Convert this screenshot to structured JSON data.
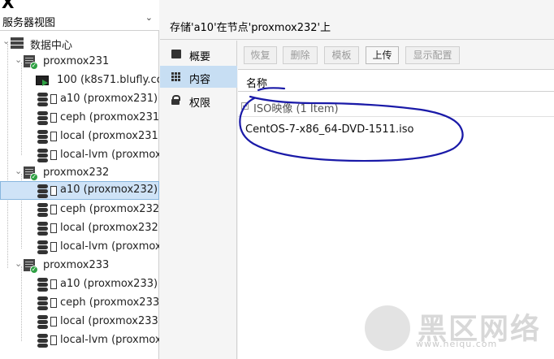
{
  "view_selector": {
    "label": "服务器视图"
  },
  "tree": {
    "datacenter": "数据中心",
    "nodes": [
      {
        "name": "proxmox231",
        "children": [
          {
            "type": "vm",
            "label": "100 (k8s71.blufly.com"
          },
          {
            "type": "storage",
            "label": "a10 (proxmox231)"
          },
          {
            "type": "storage",
            "label": "ceph (proxmox231)"
          },
          {
            "type": "storage",
            "label": "local (proxmox231)"
          },
          {
            "type": "storage",
            "label": "local-lvm (proxmox23"
          }
        ]
      },
      {
        "name": "proxmox232",
        "children": [
          {
            "type": "storage",
            "label": "a10 (proxmox232)",
            "selected": true
          },
          {
            "type": "storage",
            "label": "ceph (proxmox232)"
          },
          {
            "type": "storage",
            "label": "local (proxmox232)"
          },
          {
            "type": "storage",
            "label": "local-lvm (proxmox23"
          }
        ]
      },
      {
        "name": "proxmox233",
        "children": [
          {
            "type": "storage",
            "label": "a10 (proxmox233)"
          },
          {
            "type": "storage",
            "label": "ceph (proxmox233)"
          },
          {
            "type": "storage",
            "label": "local (proxmox233)"
          },
          {
            "type": "storage",
            "label": "local-lvm (proxmox23"
          }
        ]
      }
    ]
  },
  "header": {
    "title": "存储'a10'在节点'proxmox232'上"
  },
  "tabs": [
    {
      "label": "概要",
      "icon": "book-icon"
    },
    {
      "label": "内容",
      "icon": "grid-icon",
      "active": true
    },
    {
      "label": "权限",
      "icon": "lock-icon"
    }
  ],
  "toolbar": {
    "restore": "恢复",
    "remove": "删除",
    "template": "模板",
    "upload": "上传",
    "show_config": "显示配置"
  },
  "grid": {
    "column_name": "名称",
    "group_label": "ISO映像 (1 Item)",
    "rows": [
      "CentOS-7-x86_64-DVD-1511.iso"
    ]
  },
  "watermark": {
    "text": "黑区网络",
    "url": "www.heiqu.com"
  },
  "colors": {
    "selection": "#cfe3f7",
    "active_tab": "#c7def3",
    "annotation": "#1a1aa8",
    "status_ok": "#2ea043"
  }
}
